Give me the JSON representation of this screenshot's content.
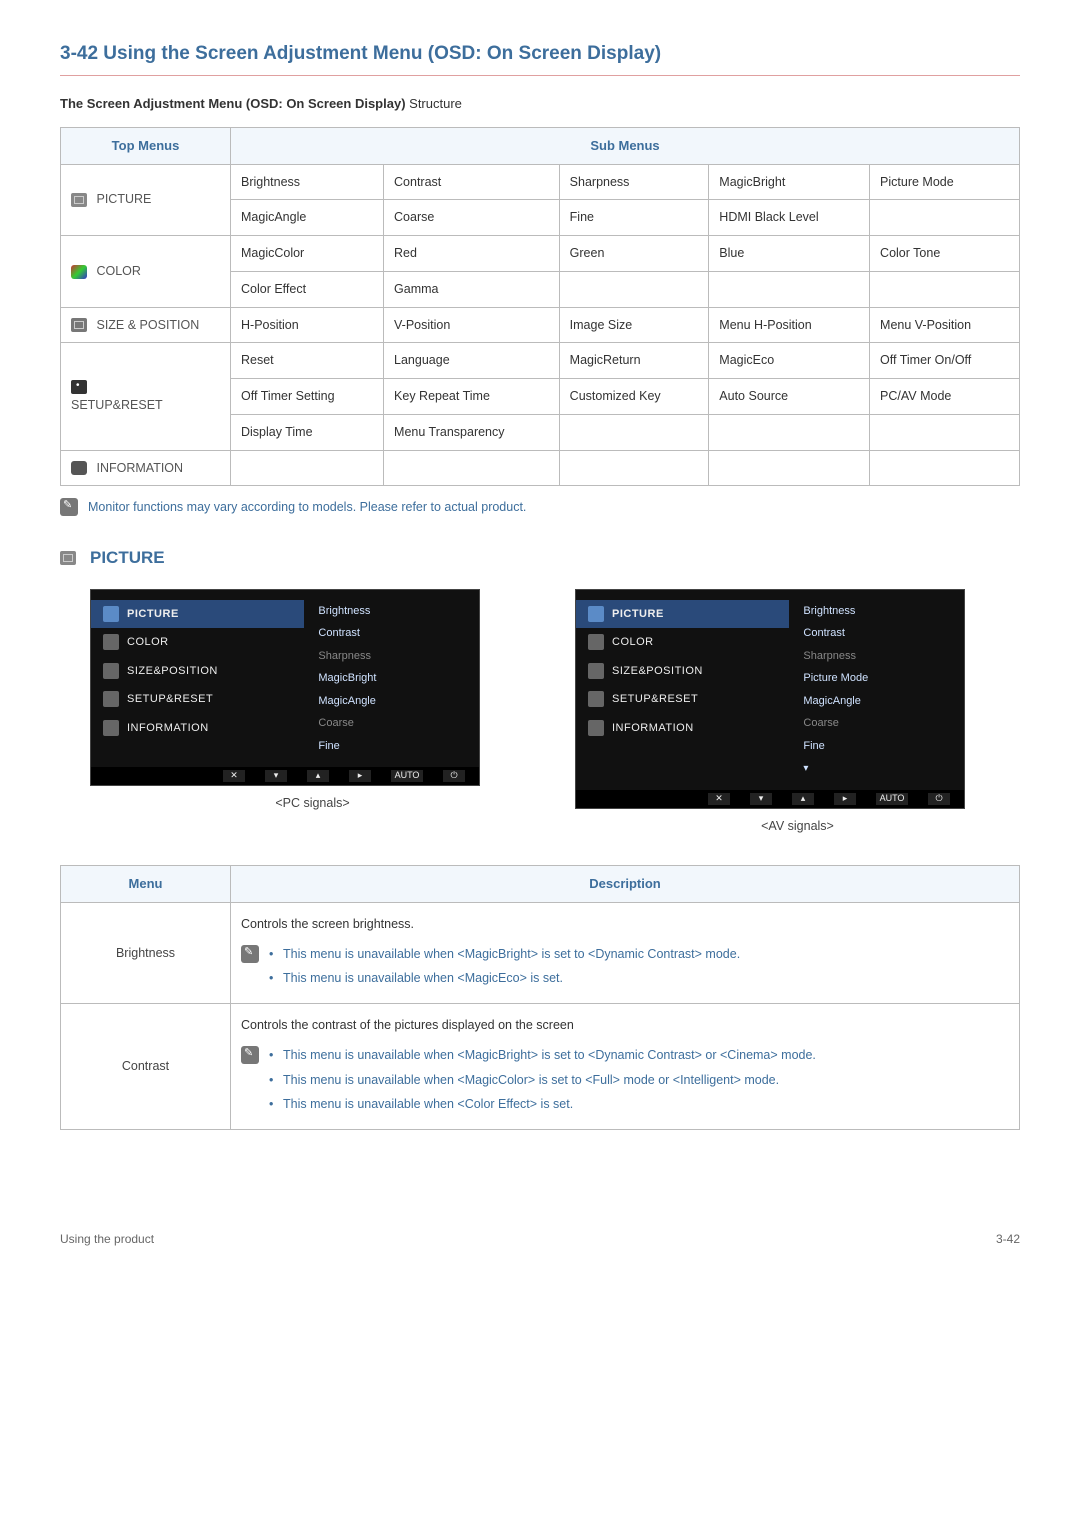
{
  "heading": "3-42  Using the Screen Adjustment Menu (OSD: On Screen Display)",
  "sub_heading_bold": "The Screen Adjustment Menu (OSD: On Screen Display)",
  "sub_heading_rest": " Structure",
  "table_headers": {
    "top": "Top Menus",
    "sub": "Sub Menus"
  },
  "menus": {
    "picture": {
      "label": "PICTURE",
      "rows": [
        [
          "Brightness",
          "Contrast",
          "Sharpness",
          "MagicBright",
          "Picture Mode"
        ],
        [
          "MagicAngle",
          "Coarse",
          "Fine",
          "HDMI Black Level",
          ""
        ]
      ]
    },
    "color": {
      "label": "COLOR",
      "rows": [
        [
          "MagicColor",
          "Red",
          "Green",
          "Blue",
          "Color Tone"
        ],
        [
          "Color Effect",
          "Gamma",
          "",
          "",
          ""
        ]
      ]
    },
    "sizepos": {
      "label": "SIZE & POSITION",
      "rows": [
        [
          "H-Position",
          "V-Position",
          "Image Size",
          "Menu H-Position",
          "Menu V-Position"
        ]
      ]
    },
    "setup": {
      "label": "SETUP&RESET",
      "rows": [
        [
          "Reset",
          "Language",
          "MagicReturn",
          "MagicEco",
          "Off Timer On/Off"
        ],
        [
          "Off Timer Setting",
          "Key Repeat Time",
          "Customized Key",
          "Auto Source",
          "PC/AV Mode"
        ],
        [
          "Display Time",
          "Menu Transparency",
          "",
          "",
          ""
        ]
      ]
    },
    "info": {
      "label": "INFORMATION",
      "rows": [
        [
          "",
          "",
          "",
          "",
          ""
        ]
      ]
    }
  },
  "note": "Monitor functions may vary according to models. Please refer to actual product.",
  "picture_section_label": "PICTURE",
  "osd": {
    "left_items": [
      {
        "label": "PICTURE",
        "active": true
      },
      {
        "label": "COLOR"
      },
      {
        "label": "SIZE&POSITION"
      },
      {
        "label": "SETUP&RESET"
      },
      {
        "label": "INFORMATION"
      }
    ],
    "pc_right": [
      {
        "label": "Brightness"
      },
      {
        "label": "Contrast"
      },
      {
        "label": "Sharpness",
        "dim": true
      },
      {
        "label": "MagicBright"
      },
      {
        "label": "MagicAngle"
      },
      {
        "label": "Coarse",
        "dim": true
      },
      {
        "label": "Fine"
      }
    ],
    "av_right": [
      {
        "label": "Brightness"
      },
      {
        "label": "Contrast"
      },
      {
        "label": "Sharpness",
        "dim": true
      },
      {
        "label": "Picture Mode"
      },
      {
        "label": "MagicAngle"
      },
      {
        "label": "Coarse",
        "dim": true
      },
      {
        "label": "Fine"
      }
    ],
    "footer_btns": [
      "✕",
      "▾",
      "▴",
      "▸",
      "AUTO",
      "⏻"
    ]
  },
  "captions": {
    "pc": "<PC signals>",
    "av": "<AV signals>"
  },
  "desc_headers": {
    "menu": "Menu",
    "desc": "Description"
  },
  "desc_rows": {
    "brightness": {
      "name": "Brightness",
      "lead": "Controls the screen brightness.",
      "notes": [
        "This menu is unavailable when <MagicBright> is set to <Dynamic Contrast> mode.",
        "This menu is unavailable when <MagicEco> is set."
      ]
    },
    "contrast": {
      "name": "Contrast",
      "lead": "Controls the contrast of the pictures displayed on the screen",
      "notes": [
        "This menu is unavailable when <MagicBright> is set to <Dynamic Contrast> or <Cinema> mode.",
        "This menu is unavailable when <MagicColor> is set to <Full> mode or <Intelligent> mode.",
        "This menu is unavailable when <Color Effect> is set."
      ]
    }
  },
  "footer": {
    "left": "Using the product",
    "right": "3-42"
  }
}
